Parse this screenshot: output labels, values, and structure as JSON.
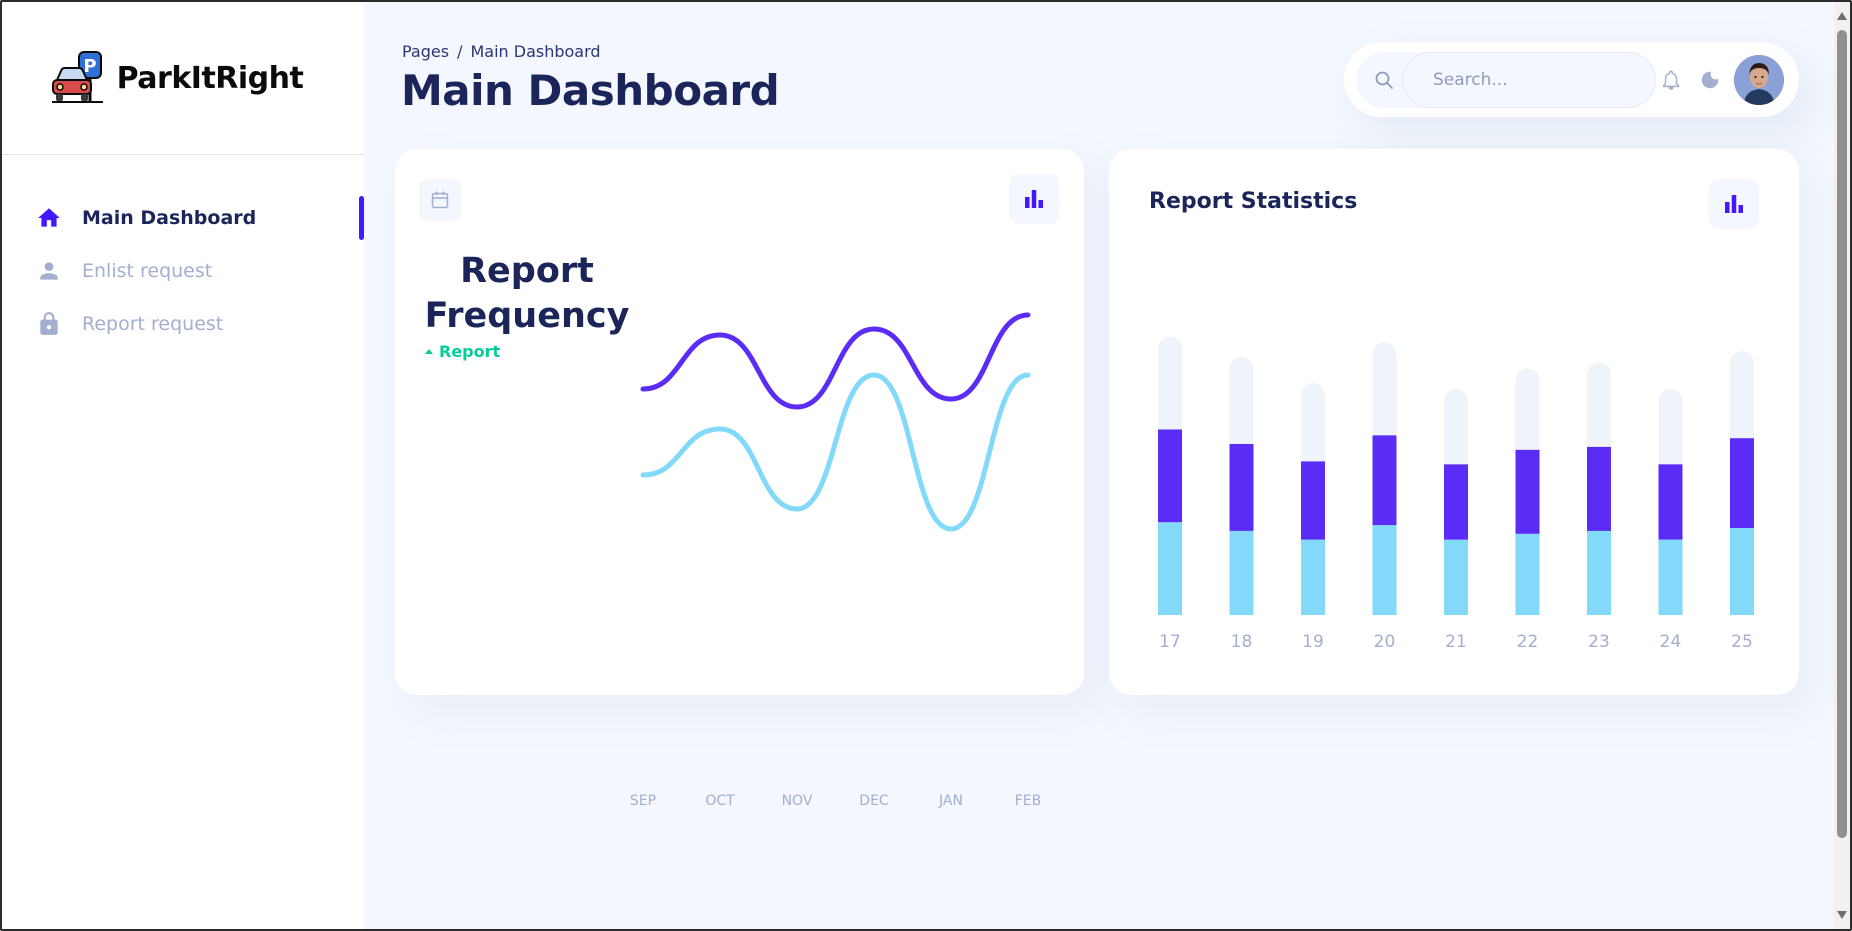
{
  "brand": {
    "name": "ParkItRight"
  },
  "sidebar": {
    "items": [
      {
        "label": "Main Dashboard",
        "icon": "home-icon",
        "active": true
      },
      {
        "label": "Enlist request",
        "icon": "person-icon",
        "active": false
      },
      {
        "label": "Report request",
        "icon": "lock-icon",
        "active": false
      }
    ]
  },
  "header": {
    "breadcrumb_root": "Pages",
    "breadcrumb_separator": "/",
    "breadcrumb_current": "Main Dashboard",
    "title": "Main Dashboard"
  },
  "topbar": {
    "search_placeholder": "Search...",
    "icons": [
      "search-icon",
      "bell-icon",
      "moon-icon"
    ]
  },
  "colors": {
    "accent": "#4318ff",
    "series_primary": "#5b2cf5",
    "series_secondary": "#82d9f9",
    "text_dark": "#1b2559",
    "text_muted": "#a3aed0",
    "trend_up": "#05cd99"
  },
  "report_frequency": {
    "title": "Report Frequency",
    "trend_label": "Report"
  },
  "report_statistics": {
    "title": "Report Statistics"
  },
  "chart_data": [
    {
      "type": "line",
      "title": "Report Frequency",
      "categories": [
        "SEP",
        "OCT",
        "NOV",
        "DEC",
        "JAN",
        "FEB"
      ],
      "series": [
        {
          "values": [
            55,
            82,
            46,
            85,
            50,
            92
          ]
        },
        {
          "values": [
            12,
            35,
            -5,
            62,
            -15,
            62
          ]
        }
      ],
      "ylim": [
        -30,
        100
      ],
      "grid": false
    },
    {
      "type": "bar",
      "stacked": true,
      "title": "Report Statistics",
      "categories": [
        "17",
        "18",
        "19",
        "20",
        "21",
        "22",
        "23",
        "24",
        "25"
      ],
      "series": [
        {
          "values": [
            32,
            29,
            26,
            31,
            26,
            28,
            29,
            26,
            30
          ]
        },
        {
          "values": [
            32,
            30,
            27,
            31,
            26,
            29,
            29,
            26,
            31
          ]
        },
        {
          "values": [
            32,
            30,
            27,
            32,
            26,
            28,
            29,
            26,
            30
          ]
        }
      ],
      "ylim": [
        0,
        100
      ],
      "grid": false
    }
  ]
}
